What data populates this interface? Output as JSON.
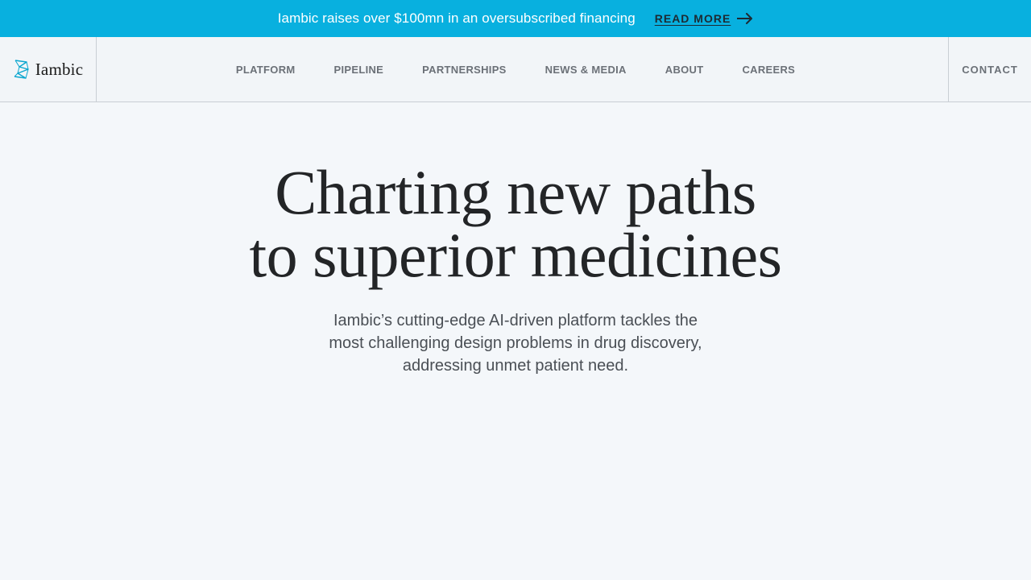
{
  "banner": {
    "text": "Iambic raises over $100mn in an oversubscribed financing",
    "link_label": "READ MORE",
    "background": "#08b0df"
  },
  "nav": {
    "logo_text": "Iambic",
    "logo_icon": "iambic-logo-icon",
    "items": [
      {
        "label": "PLATFORM"
      },
      {
        "label": "PIPELINE"
      },
      {
        "label": "PARTNERSHIPS"
      },
      {
        "label": "NEWS & MEDIA"
      },
      {
        "label": "ABOUT"
      },
      {
        "label": "CAREERS"
      }
    ],
    "contact_label": "CONTACT"
  },
  "hero": {
    "title_line1": "Charting new paths",
    "title_line2": "to superior medicines",
    "subtitle": "Iambic’s cutting-edge AI-driven platform tackles the most challenging design problems in drug discovery, addressing unmet patient need."
  }
}
